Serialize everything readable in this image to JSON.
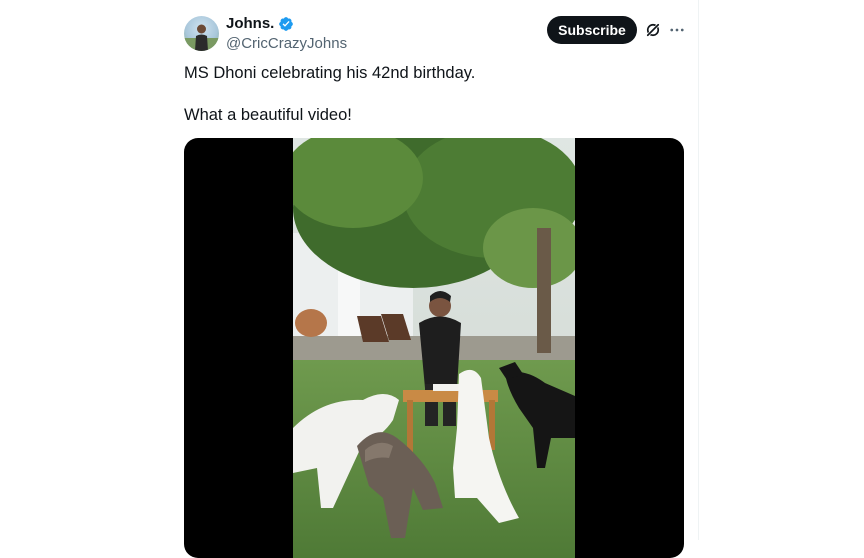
{
  "author": {
    "display_name": "Johns.",
    "handle": "@CricCrazyJohns",
    "verified": true,
    "avatar_icon": "profile-photo"
  },
  "actions": {
    "subscribe_label": "Subscribe",
    "grok_icon": "grok-icon",
    "more_icon": "more-horizontal-icon"
  },
  "tweet": {
    "lines": [
      "MS Dhoni celebrating his 42nd birthday.",
      "What a beautiful video!"
    ]
  },
  "media": {
    "type": "video",
    "scene": "man-with-cake-and-dogs-in-garden"
  },
  "colors": {
    "accent": "#1d9bf0",
    "button_bg": "#0f1419",
    "secondary_text": "#536471"
  }
}
